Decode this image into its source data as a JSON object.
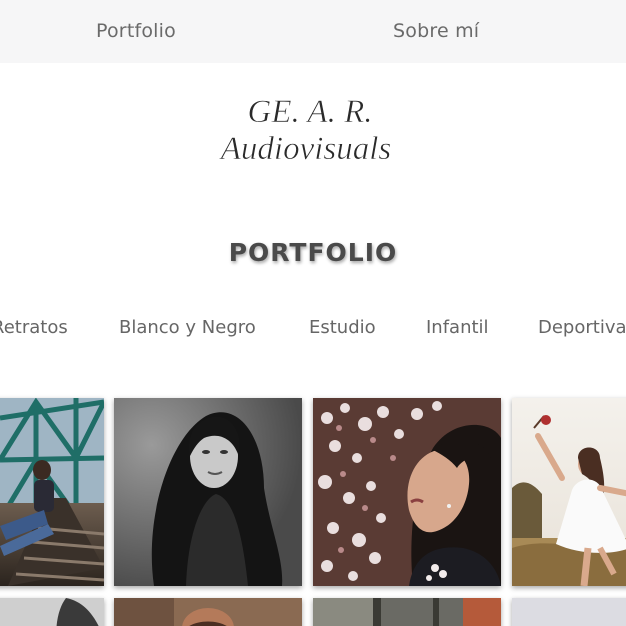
{
  "nav": {
    "items": [
      {
        "label": "Portfolio"
      },
      {
        "label": "Sobre mí"
      }
    ]
  },
  "logo": {
    "line1": "GE. A. R.",
    "line2": "Audiovisuals"
  },
  "section": {
    "title": "PORTFOLIO"
  },
  "filters": [
    {
      "label": "Retratos"
    },
    {
      "label": "Blanco y Negro"
    },
    {
      "label": "Estudio"
    },
    {
      "label": "Infantil"
    },
    {
      "label": "Deportiva"
    }
  ],
  "gallery": {
    "rows": [
      [
        {
          "subject": "woman seated on railway bridge tracks"
        },
        {
          "subject": "black and white portrait of woman with long hair"
        },
        {
          "subject": "woman smelling almond blossoms"
        },
        {
          "subject": "dancer in white dress holding a rose"
        }
      ],
      [
        {
          "subject": "black and white portrait (partially visible)"
        },
        {
          "subject": "portrait with warm tones (partially visible)"
        },
        {
          "subject": "brick building scene (partially visible)"
        },
        {
          "subject": "light grey scene (partially visible)"
        }
      ]
    ]
  }
}
